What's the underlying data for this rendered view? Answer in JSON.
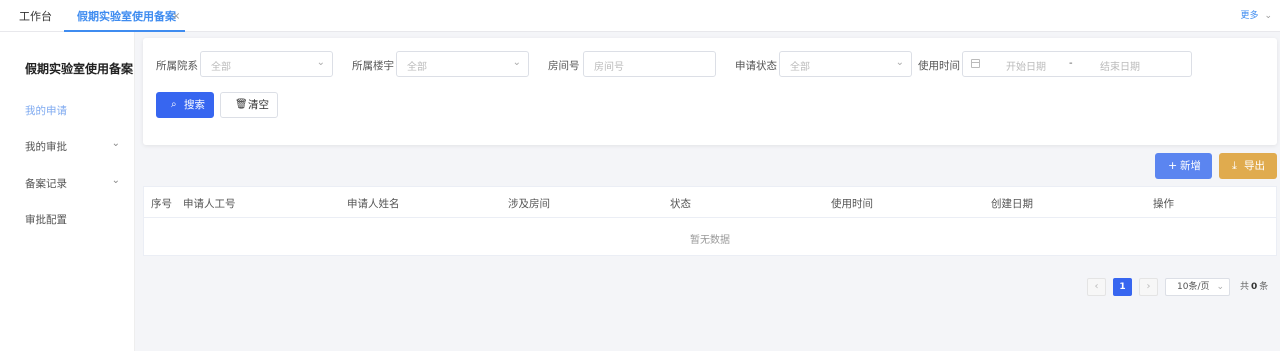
{
  "tabs": {
    "home": "工作台",
    "active": "假期实验室使用备案",
    "close": "×",
    "more": "更多"
  },
  "sidebar": {
    "title": "假期实验室使用备案",
    "items": [
      {
        "label": "我的申请"
      },
      {
        "label": "我的审批"
      },
      {
        "label": "备案记录"
      },
      {
        "label": "审批配置"
      }
    ]
  },
  "filter": {
    "college_label": "所属院系",
    "college_placeholder": "全部",
    "building_label": "所属楼宇",
    "building_placeholder": "全部",
    "room_label": "房间号",
    "room_placeholder": "房间号",
    "status_label": "申请状态",
    "status_placeholder": "全部",
    "time_label": "使用时间",
    "start_placeholder": "开始日期",
    "range_sep": "-",
    "end_placeholder": "结束日期",
    "search_btn": "搜索",
    "clear_btn": "清空"
  },
  "actions": {
    "add": "新增",
    "export": "导出"
  },
  "table": {
    "columns": [
      "序号",
      "申请人工号",
      "申请人姓名",
      "涉及房间",
      "状态",
      "使用时间",
      "创建日期",
      "操作"
    ],
    "empty_text": "暂无数据"
  },
  "pagination": {
    "prev": "‹",
    "current": "1",
    "next": "›",
    "page_size": "10条/页",
    "total_prefix": "共",
    "total_count": "0",
    "total_suffix": "条"
  },
  "colors": {
    "primary": "#3766f0",
    "tab_active": "#3f8cf0",
    "export": "#e0ab4e",
    "add": "#5b85f0"
  }
}
